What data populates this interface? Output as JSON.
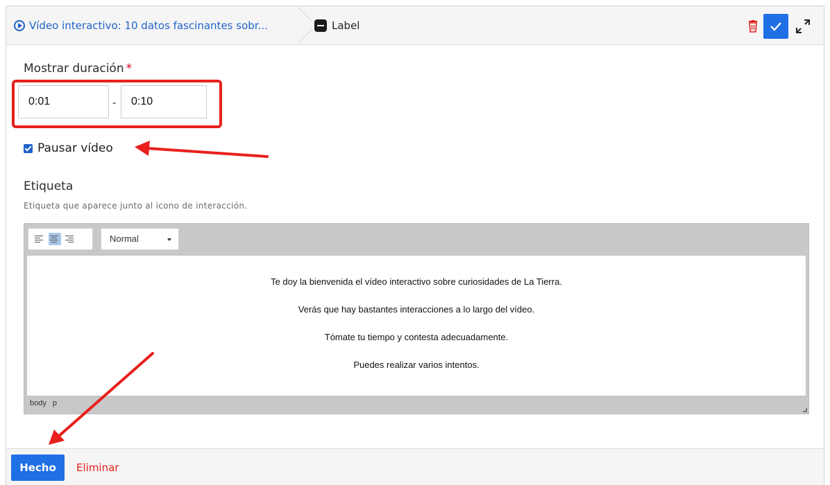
{
  "header": {
    "breadcrumb_video": "Vídeo interactivo: 10 datos fascinantes sobr...",
    "breadcrumb_label": "Label",
    "icons": {
      "video": "play-circle-icon",
      "label": "label-icon",
      "delete": "trash-icon",
      "confirm": "check-icon",
      "expand": "expand-icon"
    }
  },
  "form": {
    "duration_label": "Mostrar duración",
    "required_mark": "*",
    "start_time": "0:01",
    "separator": "-",
    "end_time": "0:10",
    "pause_video_label": "Pausar vídeo",
    "pause_video_checked": true,
    "etiqueta_title": "Etiqueta",
    "etiqueta_description": "Etiqueta que aparece junto al icono de interacción."
  },
  "editor": {
    "format_value": "Normal",
    "lines": [
      "Te doy la bienvenida el vídeo interactivo sobre curiosidades de La Tierra.",
      "Verás que hay bastantes interacciones a lo largo del vídeo.",
      "Tómate tu tiempo y contesta adecuadamente.",
      "Puedes realizar varios intentos."
    ],
    "status_path": "body p"
  },
  "footer": {
    "done_label": "Hecho",
    "delete_label": "Eliminar"
  },
  "colors": {
    "accent": "#1f6fe5",
    "link": "#1f62c9",
    "danger": "#e0201c",
    "annotation": "#e8201c"
  }
}
